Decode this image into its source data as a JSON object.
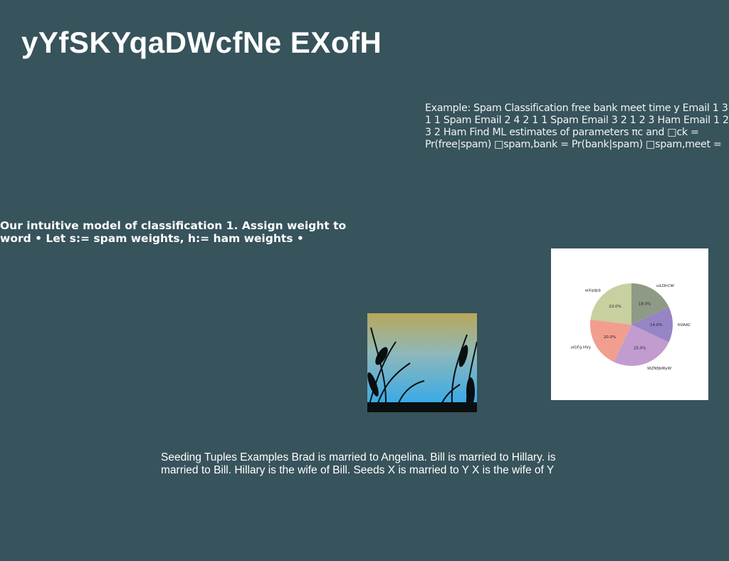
{
  "title": "yYfSKYqaDWcfNe EXofH",
  "right_text": "Example: Spam Classification free bank meet time y Email 1 3 1 1 Spam Email 2 4 2 1 1 Spam Email 3 2 1 2 3 Ham Email 1 2 3 2 Ham Find ML estimates of parameters πc and □ck = Pr(free|spam) □spam,bank = Pr(bank|spam) □spam,meet =",
  "left_text": "Our intuitive model of classification 1. Assign weight to word • Let s:= spam weights, h:= ham weights •",
  "bottom_text": "Seeding Tuples Examples Brad is married to Angelina. Bill is married to Hillary. is married to Bill. Hillary is the wife of Bill. Seeds X is married to Y X is the wife of Y",
  "chart_data": {
    "type": "pie",
    "start": "top",
    "direction": "clockwise",
    "labels": [
      "uiLOhCW",
      "KVAAC",
      "WZNfjblRyW",
      "oiGFg HVy",
      "wXqdpb"
    ],
    "values": [
      18.0,
      14.0,
      25.0,
      20.0,
      23.0
    ],
    "pct_labels": [
      "18.0%",
      "14.0%",
      "25.0%",
      "20.0%",
      "23.0%"
    ],
    "colors": [
      "#8f9a86",
      "#9585c4",
      "#c29ccf",
      "#f29e8e",
      "#c8d0a0"
    ]
  }
}
